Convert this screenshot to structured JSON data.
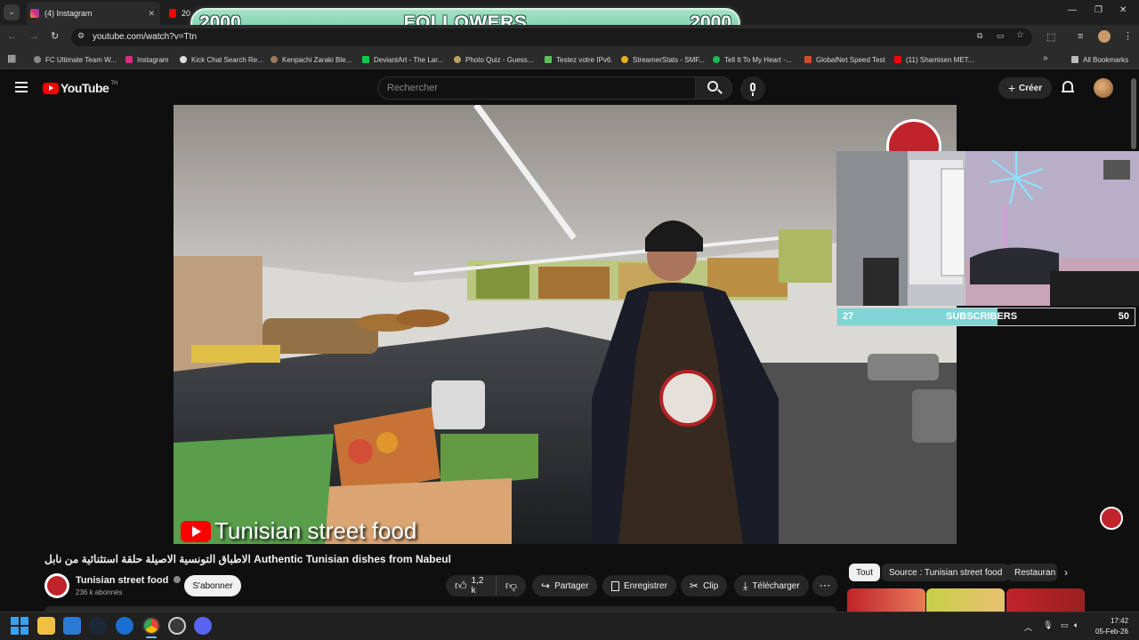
{
  "browser": {
    "tabs": [
      {
        "label": "(4) Instagram"
      },
      {
        "label": "20"
      }
    ],
    "url": "youtube.com/watch?v=Ttn",
    "bookmarks": [
      "FC Ultimate Team W...",
      "Instagram",
      "Kick Chat Search Re...",
      "Kenpachi Zaraki Ble...",
      "DeviantArt - The Lar...",
      "Photo Quiz - Guess...",
      "Testez votre IPv6.",
      "StreamerStats - SMF...",
      "Tell It To My Heart -...",
      "GlobalNet Speed Test",
      "(11) Shamisen MET..."
    ],
    "all_bookmarks": "All Bookmarks"
  },
  "overlay": {
    "followers_left": "2000",
    "followers_label": "FOLLOWERS",
    "followers_right": "2000",
    "subs_current": "27",
    "subs_label": "SUBSCRIBERS",
    "subs_goal": "50",
    "subs_progress": 0.54
  },
  "youtube": {
    "logo_text": "YouTube",
    "logo_region": "TN",
    "search_placeholder": "Rechercher",
    "create_label": "Créer",
    "video": {
      "watermark": "Tunisian street food",
      "title": "الاطباق التونسية الاصيلة حلقة استثنائية من نابل Authentic Tunisian dishes from Nabeul",
      "channel": "Tunisian street food",
      "subscribers": "236 k abonnés",
      "subscribe_label": "S'abonner",
      "likes": "1,2 k",
      "share": "Partager",
      "save": "Enregistrer",
      "clip": "Clip",
      "download": "Télécharger"
    },
    "chips": [
      "Tout",
      "Source : Tunisian street food",
      "Restauran"
    ]
  },
  "taskbar": {
    "time": "17:42",
    "date": "05-Feb-26"
  },
  "colors": {
    "youtube_red": "#ff0000",
    "overlay_green": "#7fd1ae",
    "subs_bar": "#7fd5d5"
  }
}
